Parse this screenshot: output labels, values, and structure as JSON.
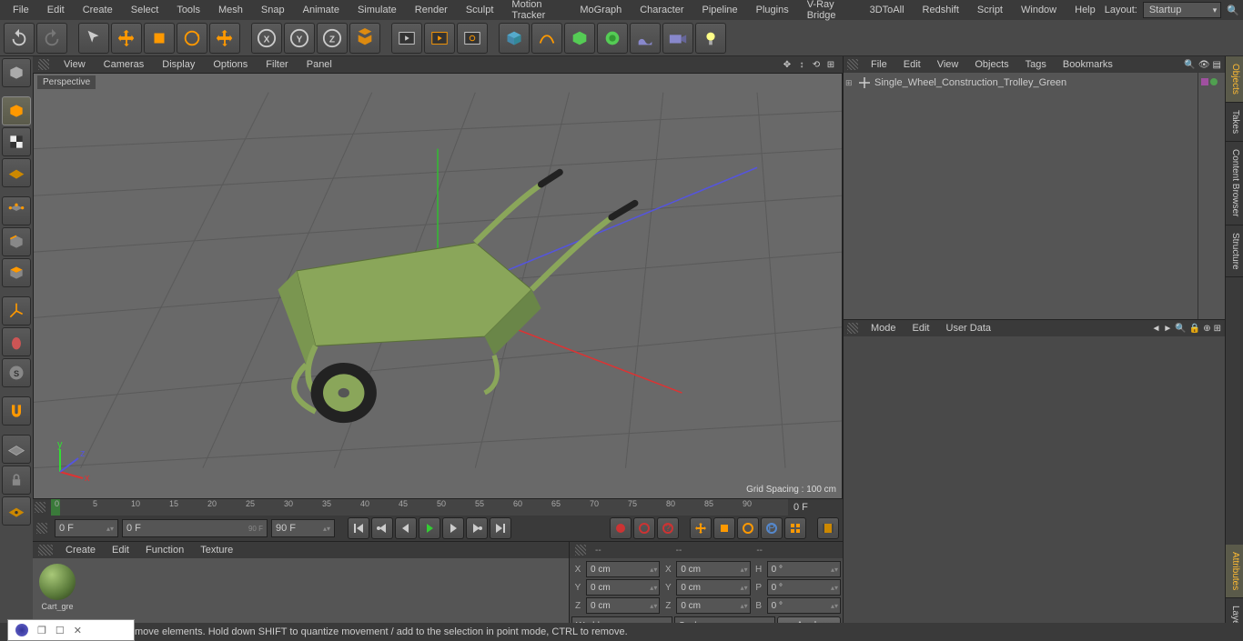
{
  "menubar": [
    "File",
    "Edit",
    "Create",
    "Select",
    "Tools",
    "Mesh",
    "Snap",
    "Animate",
    "Simulate",
    "Render",
    "Sculpt",
    "Motion Tracker",
    "MoGraph",
    "Character",
    "Pipeline",
    "Plugins",
    "V-Ray Bridge",
    "3DToAll",
    "Redshift",
    "Script",
    "Window",
    "Help"
  ],
  "layout_label": "Layout:",
  "layout_value": "Startup",
  "viewport": {
    "menu": [
      "View",
      "Cameras",
      "Display",
      "Options",
      "Filter",
      "Panel"
    ],
    "label": "Perspective",
    "grid_spacing": "Grid Spacing : 100 cm"
  },
  "timeline": {
    "start": "0 F",
    "end_display": "0 F",
    "ticks": [
      0,
      5,
      10,
      15,
      20,
      25,
      30,
      35,
      40,
      45,
      50,
      55,
      60,
      65,
      70,
      75,
      80,
      85,
      90
    ],
    "range_start": "0 F",
    "range_end": "90 F",
    "current": "90 F"
  },
  "objects": {
    "menu": [
      "File",
      "Edit",
      "View",
      "Objects",
      "Tags",
      "Bookmarks"
    ],
    "items": [
      {
        "name": "Single_Wheel_Construction_Trolley_Green"
      }
    ]
  },
  "attributes": {
    "menu": [
      "Mode",
      "Edit",
      "User Data"
    ]
  },
  "materials": {
    "menu": [
      "Create",
      "Edit",
      "Function",
      "Texture"
    ],
    "items": [
      {
        "name": "Cart_gre"
      }
    ]
  },
  "coords": {
    "header": [
      "--",
      "--",
      "--"
    ],
    "rows": [
      {
        "l1": "X",
        "v1": "0 cm",
        "l2": "X",
        "v2": "0 cm",
        "l3": "H",
        "v3": "0 °"
      },
      {
        "l1": "Y",
        "v1": "0 cm",
        "l2": "Y",
        "v2": "0 cm",
        "l3": "P",
        "v3": "0 °"
      },
      {
        "l1": "Z",
        "v1": "0 cm",
        "l2": "Z",
        "v2": "0 cm",
        "l3": "B",
        "v3": "0 °"
      }
    ],
    "mode1": "World",
    "mode2": "Scale",
    "apply": "Apply"
  },
  "sidetabs_top": [
    "Objects",
    "Takes",
    "Content Browser",
    "Structure"
  ],
  "sidetabs_bot": [
    "Attributes",
    "Layers"
  ],
  "statusbar": "move elements. Hold down SHIFT to quantize movement / add to the selection in point mode, CTRL to remove."
}
